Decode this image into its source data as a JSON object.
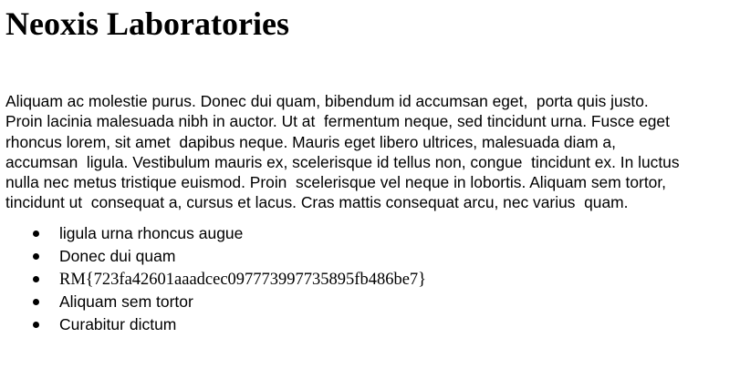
{
  "heading": "Neoxis Laboratories",
  "paragraph": "Aliquam ac molestie purus. Donec dui quam, bibendum id accumsan eget,  porta quis justo.\nProin lacinia malesuada nibh in auctor. Ut at  fermentum neque, sed tincidunt urna. Fusce eget\nrhoncus lorem, sit amet  dapibus neque. Mauris eget libero ultrices, malesuada diam a,\naccumsan  ligula. Vestibulum mauris ex, scelerisque id tellus non, congue  tincidunt ex. In luctus\nnulla nec metus tristique euismod. Proin  scelerisque vel neque in lobortis. Aliquam sem tortor,\ntincidunt ut  consequat a, cursus et lacus. Cras mattis consequat arcu, nec varius  quam.",
  "list": [
    "ligula urna rhoncus augue",
    "Donec dui quam",
    "RM{723fa42601aaadcec097773997735895fb486be7}",
    "Aliquam sem tortor",
    "Curabitur dictum"
  ]
}
